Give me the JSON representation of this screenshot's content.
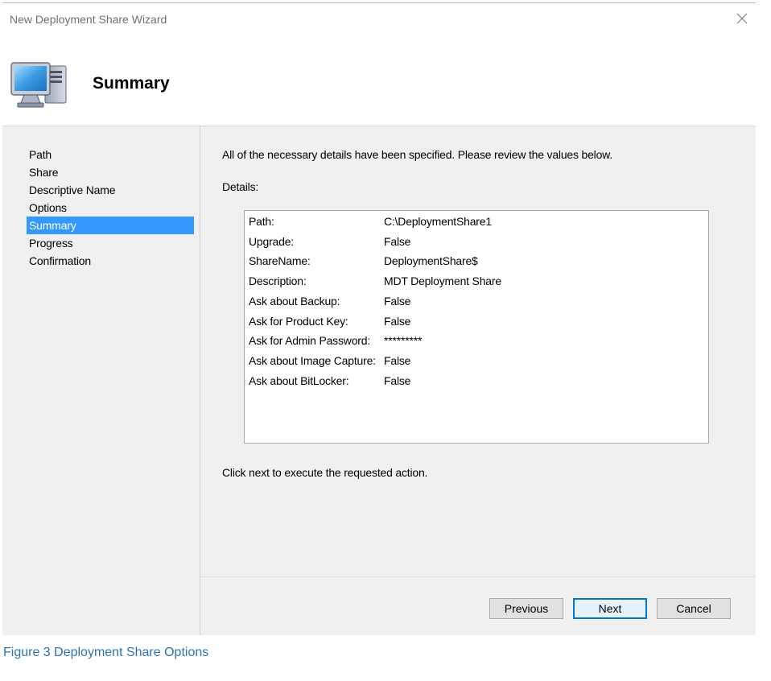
{
  "window": {
    "title": "New Deployment Share Wizard",
    "close_icon": "close-icon"
  },
  "header": {
    "icon": "computer-icon",
    "title": "Summary"
  },
  "steps": [
    {
      "label": "Path",
      "active": false
    },
    {
      "label": "Share",
      "active": false
    },
    {
      "label": "Descriptive Name",
      "active": false
    },
    {
      "label": "Options",
      "active": false
    },
    {
      "label": "Summary",
      "active": true
    },
    {
      "label": "Progress",
      "active": false
    },
    {
      "label": "Confirmation",
      "active": false
    }
  ],
  "main": {
    "intro": "All of the necessary details have been specified.  Please review the values below.",
    "details_label": "Details:",
    "details": [
      {
        "key": "Path:",
        "value": "C:\\DeploymentShare1"
      },
      {
        "key": "Upgrade:",
        "value": "False"
      },
      {
        "key": "ShareName:",
        "value": "DeploymentShare$"
      },
      {
        "key": "Description:",
        "value": "MDT Deployment Share"
      },
      {
        "key": "Ask about Backup:",
        "value": "False"
      },
      {
        "key": "Ask for Product Key:",
        "value": "False"
      },
      {
        "key": "Ask for Admin Password:",
        "value": "*********"
      },
      {
        "key": "Ask about Image Capture:",
        "value": "False"
      },
      {
        "key": "Ask about BitLocker:",
        "value": "False"
      }
    ],
    "note": "Click next to execute the requested action."
  },
  "buttons": {
    "previous": "Previous",
    "next": "Next",
    "cancel": "Cancel"
  },
  "caption": "Figure 3 Deployment Share Options",
  "colors": {
    "selection": "#3399ff",
    "caption": "#2e74b5",
    "default_button_border": "#0078d7"
  }
}
